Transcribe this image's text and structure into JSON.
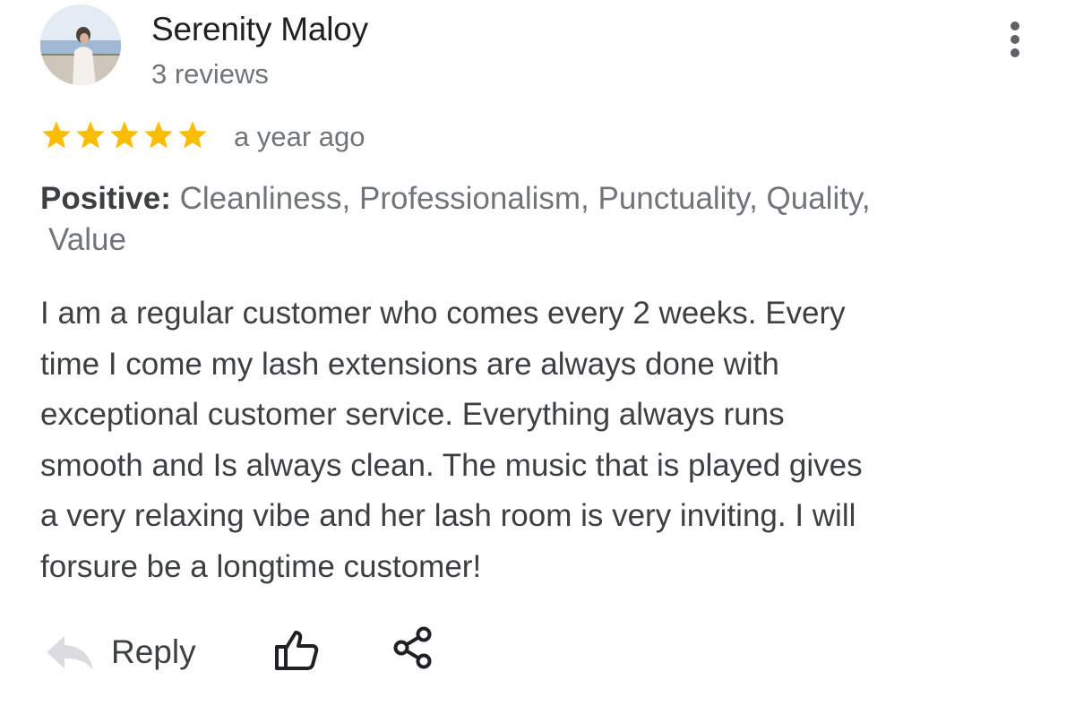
{
  "reviewer": {
    "name": "Serenity Maloy",
    "review_count": "3 reviews",
    "avatar_icon": "profile-photo"
  },
  "rating": {
    "stars": 5,
    "max_stars": 5,
    "star_color": "#fbbc04",
    "time_ago": "a year ago"
  },
  "attributes": {
    "label": "Positive:",
    "values_line1": " Cleanliness, Professionalism, Punctuality, Quality,",
    "values_line2": "Value"
  },
  "review_text": {
    "lines": [
      "I am a regular customer who comes every 2 weeks. Every",
      "time I come my lash extensions are always done with",
      "exceptional customer service. Everything always runs",
      "smooth and Is always clean. The music that is played gives",
      "a very relaxing vibe and her lash room  is very inviting. I will",
      "forsure be a longtime customer!"
    ]
  },
  "actions": {
    "reply_label": "Reply",
    "reply_icon": "reply-arrow-icon",
    "like_icon": "thumbs-up-icon",
    "share_icon": "share-icon",
    "more_icon": "more-vert-icon"
  }
}
